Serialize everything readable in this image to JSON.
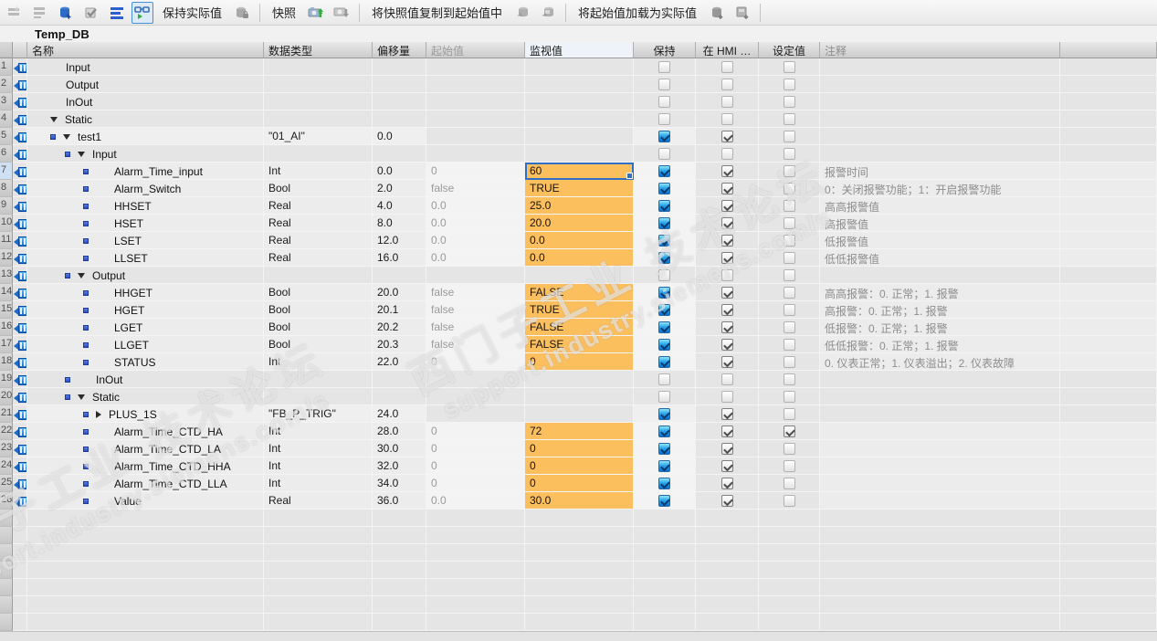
{
  "toolbar": {
    "labels": {
      "keep_actual": "保持实际值",
      "snapshot": "快照",
      "copy_snapshot_to_start": "将快照值复制到起始值中",
      "load_start_as_actual": "将起始值加载为实际值"
    },
    "icons": [
      "insert-row-icon",
      "add-row-icon",
      "keep-actual-values-icon",
      "initialize-setpoints-icon",
      "expanded-mode-icon",
      "monitor-all-icon",
      "retain-icon",
      "snapshot-up-icon",
      "snapshot-down-icon",
      "copy-start-icon-1",
      "copy-start-icon-2",
      "load-actual-icon-1",
      "load-actual-icon-2"
    ]
  },
  "title": "Temp_DB",
  "colors": {
    "monitor_orange": "#fcbf5e",
    "selection_blue": "#2f6fc4",
    "checkbox_blue": "#1d9ad6"
  },
  "watermark": {
    "line1": "西门子工业 技术论坛",
    "line2": "support.industry.siemens.com/s"
  },
  "table": {
    "columns": [
      "名称",
      "数据类型",
      "偏移量",
      "起始值",
      "监视值",
      "保持",
      "在 HMI …",
      "设定值",
      "注释"
    ],
    "filler_rows": 7,
    "rows": [
      {
        "num": 1,
        "name": "Input",
        "pad": 37,
        "square": false,
        "exp": "",
        "type": "",
        "offset": "",
        "start": "",
        "monitor": "",
        "orange": false,
        "selected": false,
        "retain": "off",
        "hmi": "off",
        "setp": "off",
        "comment": "",
        "cls": ""
      },
      {
        "num": 2,
        "name": "Output",
        "pad": 37,
        "square": false,
        "exp": "",
        "type": "",
        "offset": "",
        "start": "",
        "monitor": "",
        "orange": false,
        "selected": false,
        "retain": "off",
        "hmi": "off",
        "setp": "off",
        "comment": "",
        "cls": ""
      },
      {
        "num": 3,
        "name": "InOut",
        "pad": 37,
        "square": false,
        "exp": "",
        "type": "",
        "offset": "",
        "start": "",
        "monitor": "",
        "orange": false,
        "selected": false,
        "retain": "off",
        "hmi": "off",
        "setp": "off",
        "comment": "",
        "cls": ""
      },
      {
        "num": 4,
        "name": "Static",
        "pad": 20,
        "square": false,
        "exp": "down",
        "type": "",
        "offset": "",
        "start": "",
        "monitor": "",
        "orange": false,
        "selected": false,
        "retain": "off",
        "hmi": "off",
        "setp": "off",
        "comment": "",
        "cls": ""
      },
      {
        "num": 5,
        "name": "test1",
        "pad": 20,
        "square": true,
        "exp": "down",
        "type": "\"01_AI\"",
        "offset": "0.0",
        "start": "",
        "monitor": "",
        "orange": false,
        "selected": false,
        "retain": "blue",
        "hmi": "gray",
        "setp": "off",
        "comment": "",
        "cls": "grp"
      },
      {
        "num": 6,
        "name": "Input",
        "pad": 36,
        "square": true,
        "exp": "down",
        "type": "",
        "offset": "",
        "start": "",
        "monitor": "",
        "orange": false,
        "selected": false,
        "retain": "off",
        "hmi": "off",
        "setp": "off",
        "comment": "",
        "cls": ""
      },
      {
        "num": 7,
        "name": "Alarm_Time_input",
        "pad": 56,
        "square": true,
        "exp": "",
        "type": "Int",
        "offset": "0.0",
        "start": "0",
        "monitor": "60",
        "orange": true,
        "selected": true,
        "retain": "blue",
        "hmi": "gray",
        "setp": "off",
        "comment": "报警时间",
        "cls": "en"
      },
      {
        "num": 8,
        "name": "Alarm_Switch",
        "pad": 56,
        "square": true,
        "exp": "",
        "type": "Bool",
        "offset": "2.0",
        "start": "false",
        "monitor": "TRUE",
        "orange": true,
        "selected": false,
        "retain": "blue",
        "hmi": "gray",
        "setp": "off",
        "comment": "0：关闭报警功能；1：开启报警功能",
        "cls": "en"
      },
      {
        "num": 9,
        "name": "HHSET",
        "pad": 56,
        "square": true,
        "exp": "",
        "type": "Real",
        "offset": "4.0",
        "start": "0.0",
        "monitor": "25.0",
        "orange": true,
        "selected": false,
        "retain": "blue",
        "hmi": "gray",
        "setp": "off",
        "comment": "高高报警值",
        "cls": "en"
      },
      {
        "num": 10,
        "name": "HSET",
        "pad": 56,
        "square": true,
        "exp": "",
        "type": "Real",
        "offset": "8.0",
        "start": "0.0",
        "monitor": "20.0",
        "orange": true,
        "selected": false,
        "retain": "blue",
        "hmi": "gray",
        "setp": "off",
        "comment": "高报警值",
        "cls": "en"
      },
      {
        "num": 11,
        "name": "LSET",
        "pad": 56,
        "square": true,
        "exp": "",
        "type": "Real",
        "offset": "12.0",
        "start": "0.0",
        "monitor": "0.0",
        "orange": true,
        "selected": false,
        "retain": "blue",
        "hmi": "gray",
        "setp": "off",
        "comment": "低报警值",
        "cls": "en"
      },
      {
        "num": 12,
        "name": "LLSET",
        "pad": 56,
        "square": true,
        "exp": "",
        "type": "Real",
        "offset": "16.0",
        "start": "0.0",
        "monitor": "0.0",
        "orange": true,
        "selected": false,
        "retain": "blue",
        "hmi": "gray",
        "setp": "off",
        "comment": "低低报警值",
        "cls": "en"
      },
      {
        "num": 13,
        "name": "Output",
        "pad": 36,
        "square": true,
        "exp": "down",
        "type": "",
        "offset": "",
        "start": "",
        "monitor": "",
        "orange": false,
        "selected": false,
        "retain": "off",
        "hmi": "off",
        "setp": "off",
        "comment": "",
        "cls": ""
      },
      {
        "num": 14,
        "name": "HHGET",
        "pad": 56,
        "square": true,
        "exp": "",
        "type": "Bool",
        "offset": "20.0",
        "start": "false",
        "monitor": "FALSE",
        "orange": true,
        "selected": false,
        "retain": "blue",
        "hmi": "gray",
        "setp": "off",
        "comment": "高高报警：0. 正常；1. 报警",
        "cls": "en"
      },
      {
        "num": 15,
        "name": "HGET",
        "pad": 56,
        "square": true,
        "exp": "",
        "type": "Bool",
        "offset": "20.1",
        "start": "false",
        "monitor": "TRUE",
        "orange": true,
        "selected": false,
        "retain": "blue",
        "hmi": "gray",
        "setp": "off",
        "comment": "高报警：0. 正常；1. 报警",
        "cls": "en"
      },
      {
        "num": 16,
        "name": "LGET",
        "pad": 56,
        "square": true,
        "exp": "",
        "type": "Bool",
        "offset": "20.2",
        "start": "false",
        "monitor": "FALSE",
        "orange": true,
        "selected": false,
        "retain": "blue",
        "hmi": "gray",
        "setp": "off",
        "comment": "低报警：0. 正常；1. 报警",
        "cls": "en"
      },
      {
        "num": 17,
        "name": "LLGET",
        "pad": 56,
        "square": true,
        "exp": "",
        "type": "Bool",
        "offset": "20.3",
        "start": "false",
        "monitor": "FALSE",
        "orange": true,
        "selected": false,
        "retain": "blue",
        "hmi": "gray",
        "setp": "off",
        "comment": "低低报警：0. 正常；1. 报警",
        "cls": "en"
      },
      {
        "num": 18,
        "name": "STATUS",
        "pad": 56,
        "square": true,
        "exp": "",
        "type": "Int",
        "offset": "22.0",
        "start": "0",
        "monitor": "0",
        "orange": true,
        "selected": false,
        "retain": "blue",
        "hmi": "gray",
        "setp": "off",
        "comment": "0. 仪表正常；1. 仪表溢出；2. 仪表故障",
        "cls": "en"
      },
      {
        "num": 19,
        "name": "InOut",
        "pad": 36,
        "square": true,
        "exp": "",
        "type": "",
        "offset": "",
        "start": "",
        "monitor": "",
        "orange": false,
        "selected": false,
        "retain": "off",
        "hmi": "off",
        "setp": "off",
        "comment": "",
        "cls": ""
      },
      {
        "num": 20,
        "name": "Static",
        "pad": 36,
        "square": true,
        "exp": "down",
        "type": "",
        "offset": "",
        "start": "",
        "monitor": "",
        "orange": false,
        "selected": false,
        "retain": "off",
        "hmi": "off",
        "setp": "off",
        "comment": "",
        "cls": ""
      },
      {
        "num": 21,
        "name": "PLUS_1S",
        "pad": 56,
        "square": true,
        "exp": "right",
        "type": "\"FB_P_TRIG\"",
        "offset": "24.0",
        "start": "",
        "monitor": "",
        "orange": false,
        "selected": false,
        "retain": "blue",
        "hmi": "gray",
        "setp": "off",
        "comment": "",
        "cls": "grp"
      },
      {
        "num": 22,
        "name": "Alarm_Time_CTD_HA",
        "pad": 56,
        "square": true,
        "exp": "",
        "type": "Int",
        "offset": "28.0",
        "start": "0",
        "monitor": "72",
        "orange": true,
        "selected": false,
        "retain": "blue",
        "hmi": "gray",
        "setp": "gray",
        "comment": "",
        "cls": "en"
      },
      {
        "num": 23,
        "name": "Alarm_Time_CTD_LA",
        "pad": 56,
        "square": true,
        "exp": "",
        "type": "Int",
        "offset": "30.0",
        "start": "0",
        "monitor": "0",
        "orange": true,
        "selected": false,
        "retain": "blue",
        "hmi": "gray",
        "setp": "off",
        "comment": "",
        "cls": "en"
      },
      {
        "num": 24,
        "name": "Alarm_Time_CTD_HHA",
        "pad": 56,
        "square": true,
        "exp": "",
        "type": "Int",
        "offset": "32.0",
        "start": "0",
        "monitor": "0",
        "orange": true,
        "selected": false,
        "retain": "blue",
        "hmi": "gray",
        "setp": "off",
        "comment": "",
        "cls": "en"
      },
      {
        "num": 25,
        "name": "Alarm_Time_CTD_LLA",
        "pad": 56,
        "square": true,
        "exp": "",
        "type": "Int",
        "offset": "34.0",
        "start": "0",
        "monitor": "0",
        "orange": true,
        "selected": false,
        "retain": "blue",
        "hmi": "gray",
        "setp": "off",
        "comment": "",
        "cls": "en"
      },
      {
        "num": 26,
        "name": "Value",
        "pad": 56,
        "square": true,
        "exp": "",
        "type": "Real",
        "offset": "36.0",
        "start": "0.0",
        "monitor": "30.0",
        "orange": true,
        "selected": false,
        "retain": "blue",
        "hmi": "gray",
        "setp": "off",
        "comment": "",
        "cls": "en"
      }
    ]
  }
}
